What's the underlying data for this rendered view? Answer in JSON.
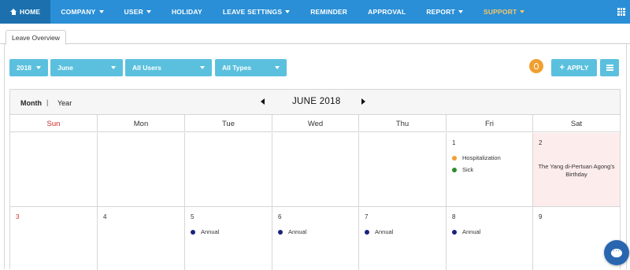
{
  "nav": {
    "items": [
      {
        "label": "HOME",
        "active": true,
        "caret": false,
        "icon": "home-icon"
      },
      {
        "label": "COMPANY",
        "caret": true
      },
      {
        "label": "USER",
        "caret": true
      },
      {
        "label": "HOLIDAY",
        "caret": false
      },
      {
        "label": "LEAVE SETTINGS",
        "caret": true
      },
      {
        "label": "REMINDER",
        "caret": false
      },
      {
        "label": "APPROVAL",
        "caret": false
      },
      {
        "label": "REPORT",
        "caret": true
      },
      {
        "label": "SUPPORT",
        "caret": true,
        "highlight": true
      }
    ],
    "apps_icon": "grid-icon"
  },
  "tab": {
    "label": "Leave Overview"
  },
  "filters": {
    "year": "2018",
    "month": "June",
    "users": "All Users",
    "types": "All Types"
  },
  "actions": {
    "tips_icon": "lightbulb-icon",
    "apply_label": "APPLY",
    "apply_icon": "plus-icon",
    "list_icon": "list-icon"
  },
  "calendar": {
    "view_month": "Month",
    "view_separator": "|",
    "view_year": "Year",
    "title": "JUNE 2018",
    "prev_icon": "caret-left-icon",
    "next_icon": "caret-right-icon",
    "weekdays": [
      "Sun",
      "Mon",
      "Tue",
      "Wed",
      "Thu",
      "Fri",
      "Sat"
    ],
    "weeks": [
      [
        {
          "day": ""
        },
        {
          "day": ""
        },
        {
          "day": ""
        },
        {
          "day": ""
        },
        {
          "day": ""
        },
        {
          "day": "1",
          "events": [
            {
              "label": "Hospitalization",
              "color": "#f0a030"
            },
            {
              "label": "Sick",
              "color": "#2e8b2e"
            }
          ]
        },
        {
          "day": "2",
          "holiday": "The Yang di-Pertuan Agong's Birthday"
        }
      ],
      [
        {
          "day": "3"
        },
        {
          "day": "4"
        },
        {
          "day": "5",
          "events": [
            {
              "label": "Annual",
              "color": "#1a237e"
            }
          ]
        },
        {
          "day": "6",
          "events": [
            {
              "label": "Annual",
              "color": "#1a237e"
            }
          ]
        },
        {
          "day": "7",
          "events": [
            {
              "label": "Annual",
              "color": "#1a237e"
            }
          ]
        },
        {
          "day": "8",
          "events": [
            {
              "label": "Annual",
              "color": "#1a237e"
            }
          ]
        },
        {
          "day": "9"
        }
      ]
    ]
  },
  "chat": {
    "icon": "chat-icon"
  },
  "colors": {
    "nav_bg": "#2a8fd6",
    "nav_active": "#1b70ad",
    "filter_bg": "#5bc0de",
    "sunday": "#cc2a2a",
    "holiday_bg": "#fdecec",
    "chat_bg": "#2a66b0"
  }
}
